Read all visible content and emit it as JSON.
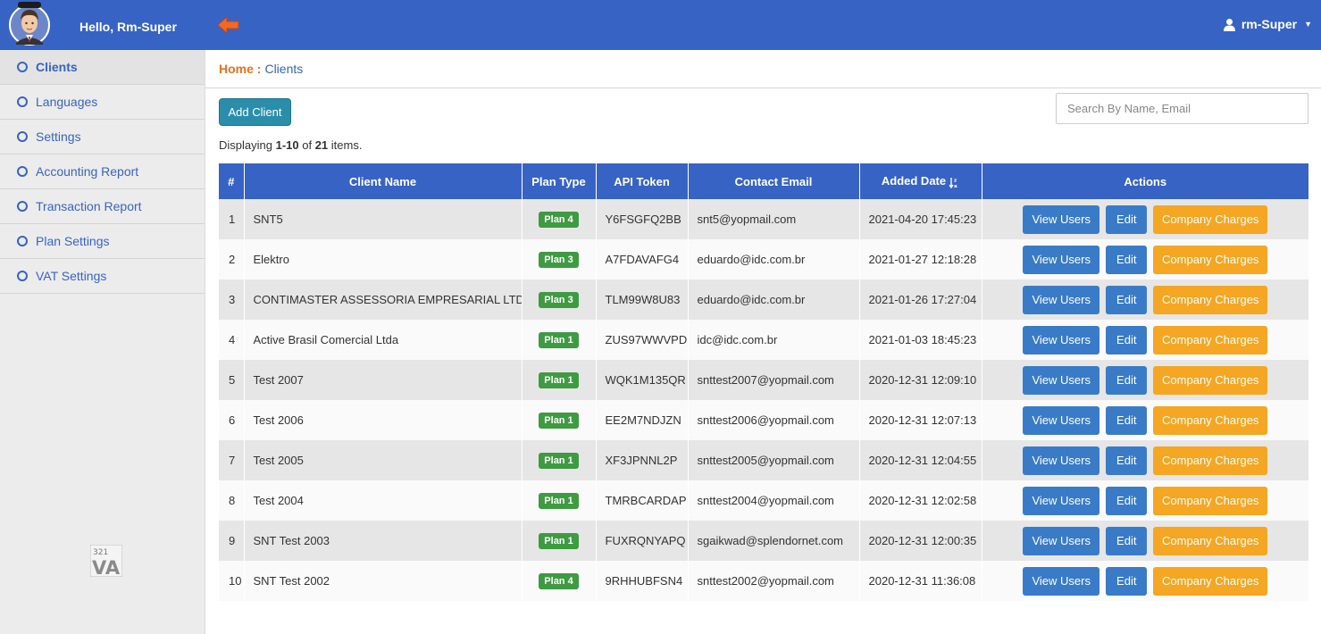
{
  "header": {
    "greeting": "Hello, Rm-Super",
    "user_menu_label": "rm-Super"
  },
  "sidebar": {
    "items": [
      {
        "label": "Clients",
        "active": true
      },
      {
        "label": "Languages"
      },
      {
        "label": "Settings"
      },
      {
        "label": "Accounting Report"
      },
      {
        "label": "Transaction Report"
      },
      {
        "label": "Plan Settings"
      },
      {
        "label": "VAT Settings"
      }
    ]
  },
  "breadcrumb": {
    "home": "Home :",
    "current": "Clients"
  },
  "toolbar": {
    "add_label": "Add Client",
    "search_placeholder": "Search By Name, Email"
  },
  "summary": {
    "prefix": "Displaying ",
    "range": "1-10",
    "middle": " of ",
    "total": "21",
    "suffix": " items."
  },
  "table": {
    "headers": [
      "#",
      "Client Name",
      "Plan Type",
      "API Token",
      "Contact Email",
      "Added Date",
      "Actions"
    ],
    "rows": [
      {
        "num": "1",
        "name": "SNT5",
        "plan": "Plan 4",
        "token": "Y6FSGFQ2BB",
        "email": "snt5@yopmail.com",
        "date": "2021-04-20 17:45:23"
      },
      {
        "num": "2",
        "name": "Elektro",
        "plan": "Plan 3",
        "token": "A7FDAVAFG4",
        "email": "eduardo@idc.com.br",
        "date": "2021-01-27 12:18:28"
      },
      {
        "num": "3",
        "name": "CONTIMASTER ASSESSORIA EMPRESARIAL LTDA",
        "plan": "Plan 3",
        "token": "TLM99W8U83",
        "email": "eduardo@idc.com.br",
        "date": "2021-01-26 17:27:04"
      },
      {
        "num": "4",
        "name": "Active Brasil Comercial Ltda",
        "plan": "Plan 1",
        "token": "ZUS97WWVPD",
        "email": "idc@idc.com.br",
        "date": "2021-01-03 18:45:23"
      },
      {
        "num": "5",
        "name": "Test 2007",
        "plan": "Plan 1",
        "token": "WQK1M135QR",
        "email": "snttest2007@yopmail.com",
        "date": "2020-12-31 12:09:10"
      },
      {
        "num": "6",
        "name": "Test 2006",
        "plan": "Plan 1",
        "token": "EE2M7NDJZN",
        "email": "snttest2006@yopmail.com",
        "date": "2020-12-31 12:07:13"
      },
      {
        "num": "7",
        "name": "Test 2005",
        "plan": "Plan 1",
        "token": "XF3JPNNL2P",
        "email": "snttest2005@yopmail.com",
        "date": "2020-12-31 12:04:55"
      },
      {
        "num": "8",
        "name": "Test 2004",
        "plan": "Plan 1",
        "token": "TMRBCARDAP",
        "email": "snttest2004@yopmail.com",
        "date": "2020-12-31 12:02:58"
      },
      {
        "num": "9",
        "name": "SNT Test 2003",
        "plan": "Plan 1",
        "token": "FUXRQNYAPQ",
        "email": "sgaikwad@splendornet.com",
        "date": "2020-12-31 12:00:35"
      },
      {
        "num": "10",
        "name": "SNT Test 2002",
        "plan": "Plan 4",
        "token": "9RHHUBFSN4",
        "email": "snttest2002@yopmail.com",
        "date": "2020-12-31 11:36:08"
      }
    ],
    "action_labels": {
      "view": "View Users",
      "edit": "Edit",
      "charges": "Company Charges"
    }
  },
  "colors": {
    "topbar": "#3763c4",
    "plan_badge": "#3e9b41",
    "view_button": "#3a7bc8",
    "charges_button": "#f5a623",
    "breadcrumb_home": "#e8711f"
  },
  "icons": {
    "avatar": "user-avatar-icon",
    "back": "back-arrow-icon",
    "user": "user-icon",
    "sort": "sort-icon",
    "logo": "logo-icon"
  },
  "footer_logo": {
    "text": "321VA"
  }
}
